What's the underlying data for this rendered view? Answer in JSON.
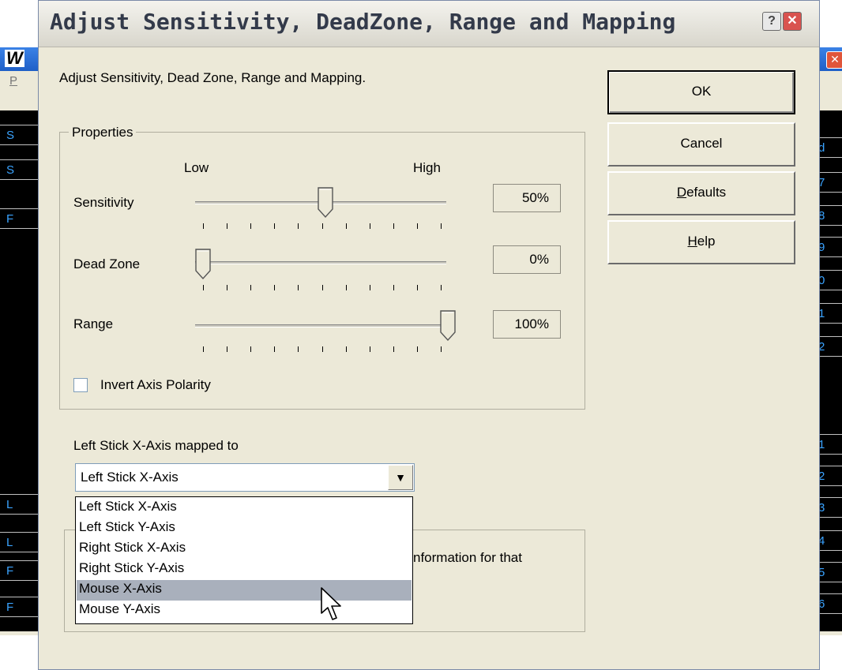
{
  "background_window": {
    "logo": "W",
    "menu_first": "P",
    "left_rows": [
      "S",
      "S",
      "F",
      "L",
      "L",
      "F",
      "F"
    ],
    "right_rows": [
      "d",
      "7",
      "8",
      "9",
      "0",
      "1",
      "2",
      "1",
      "2",
      "3",
      "4",
      "5",
      "6"
    ]
  },
  "dialog": {
    "title": "Adjust Sensitivity, DeadZone, Range and Mapping",
    "help_glyph": "?",
    "close_glyph": "✕",
    "intro": "Adjust Sensitivity, Dead Zone, Range and Mapping.",
    "properties": {
      "legend": "Properties",
      "low_label": "Low",
      "high_label": "High",
      "sliders": [
        {
          "label": "Sensitivity",
          "value_text": "50%",
          "position": 0.5
        },
        {
          "label": "Dead Zone",
          "value_text": "0%",
          "position": 0.0
        },
        {
          "label": "Range",
          "value_text": "100%",
          "position": 1.0
        }
      ],
      "invert_label": "Invert Axis Polarity",
      "invert_checked": false
    },
    "mapping": {
      "label": "Left Stick X-Axis mapped to",
      "selected": "Left Stick X-Axis",
      "options": [
        "Left Stick X-Axis",
        "Left Stick Y-Axis",
        "Right Stick X-Axis",
        "Right Stick Y-Axis",
        "Mouse X-Axis",
        "Mouse Y-Axis"
      ],
      "highlighted_index": 4
    },
    "partial_text": "nformation for that",
    "buttons": {
      "ok": "OK",
      "cancel": "Cancel",
      "defaults_prefix": "D",
      "defaults_rest": "efaults",
      "help_prefix": "H",
      "help_rest": "elp"
    }
  }
}
